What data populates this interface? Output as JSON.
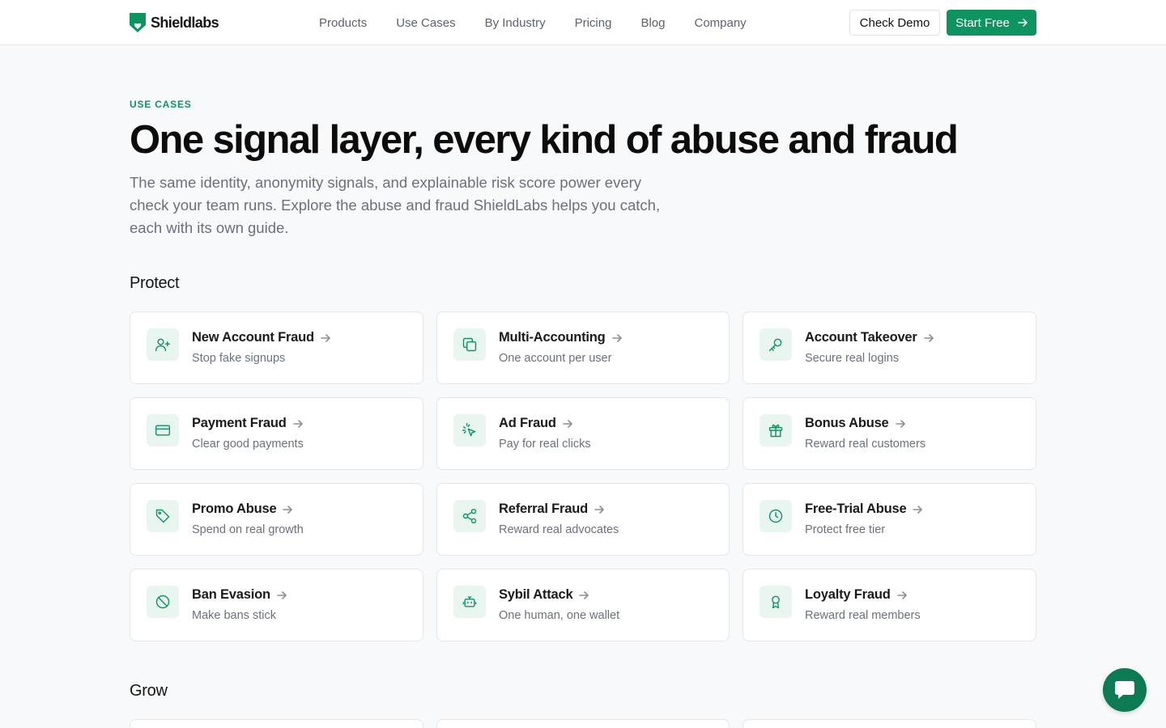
{
  "brand": {
    "name": "Shieldlabs"
  },
  "nav": {
    "items": [
      {
        "label": "Products",
        "name": "nav-products"
      },
      {
        "label": "Use Cases",
        "name": "nav-use-cases"
      },
      {
        "label": "By Industry",
        "name": "nav-by-industry"
      },
      {
        "label": "Pricing",
        "name": "nav-pricing"
      },
      {
        "label": "Blog",
        "name": "nav-blog"
      },
      {
        "label": "Company",
        "name": "nav-company"
      }
    ],
    "demo_label": "Check Demo",
    "start_label": "Start Free"
  },
  "hero": {
    "eyebrow": "USE CASES",
    "title": "One signal layer, every kind of abuse and fraud",
    "subtitle": "The same identity, anonymity signals, and explainable risk score power every check your team runs. Explore the abuse and fraud ShieldLabs helps you catch, each with its own guide."
  },
  "sections": {
    "protect": {
      "title": "Protect",
      "cards": [
        {
          "title": "New Account Fraud",
          "subtitle": "Stop fake signups",
          "icon": "user-plus-icon"
        },
        {
          "title": "Multi-Accounting",
          "subtitle": "One account per user",
          "icon": "copy-icon"
        },
        {
          "title": "Account Takeover",
          "subtitle": "Secure real logins",
          "icon": "key-icon"
        },
        {
          "title": "Payment Fraud",
          "subtitle": "Clear good payments",
          "icon": "credit-card-icon"
        },
        {
          "title": "Ad Fraud",
          "subtitle": "Pay for real clicks",
          "icon": "pointer-click-icon"
        },
        {
          "title": "Bonus Abuse",
          "subtitle": "Reward real customers",
          "icon": "gift-icon"
        },
        {
          "title": "Promo Abuse",
          "subtitle": "Spend on real growth",
          "icon": "tag-icon"
        },
        {
          "title": "Referral Fraud",
          "subtitle": "Reward real advocates",
          "icon": "share-icon"
        },
        {
          "title": "Free-Trial Abuse",
          "subtitle": "Protect free tier",
          "icon": "clock-icon"
        },
        {
          "title": "Ban Evasion",
          "subtitle": "Make bans stick",
          "icon": "ban-icon"
        },
        {
          "title": "Sybil Attack",
          "subtitle": "One human, one wallet",
          "icon": "bot-icon"
        },
        {
          "title": "Loyalty Fraud",
          "subtitle": "Reward real members",
          "icon": "award-icon"
        }
      ]
    },
    "grow": {
      "title": "Grow"
    }
  },
  "colors": {
    "accent": "#0d9460",
    "icon_bg": "#e9f6ef",
    "chat": "#0c7a52"
  }
}
